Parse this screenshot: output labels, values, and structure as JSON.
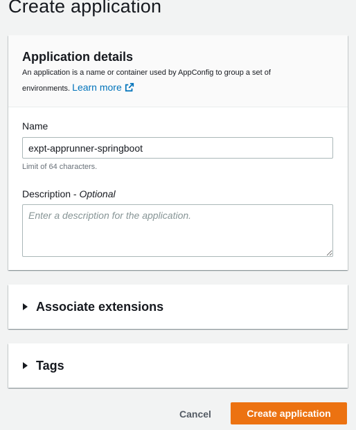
{
  "page": {
    "title": "Create application"
  },
  "details": {
    "title": "Application details",
    "description": "An application is a name or container used by AppConfig to group a set of environments.",
    "learn_more": "Learn more",
    "name_label": "Name",
    "name_value": "expt-apprunner-springboot",
    "name_constraint": "Limit of 64 characters.",
    "description_label": "Description - ",
    "description_optional": "Optional",
    "description_placeholder": "Enter a description for the application."
  },
  "sections": {
    "extensions": "Associate extensions",
    "tags": "Tags"
  },
  "actions": {
    "cancel": "Cancel",
    "create": "Create application"
  },
  "colors": {
    "primary": "#ec7211",
    "link": "#0073bb",
    "background": "#f2f3f3"
  },
  "icons": {
    "external_link": "external-link-icon",
    "expander": "caret-right-icon"
  }
}
